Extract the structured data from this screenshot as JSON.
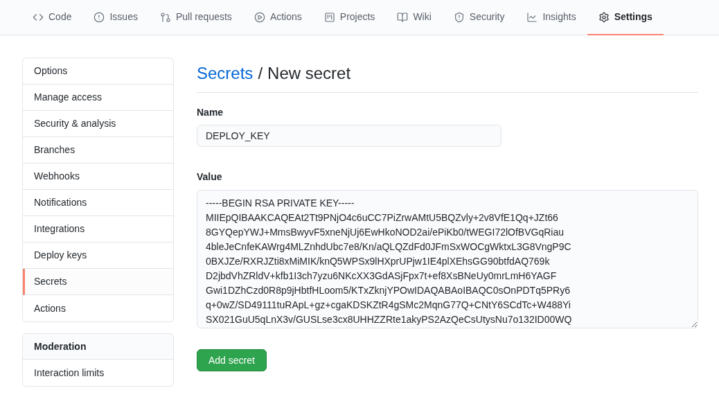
{
  "tabs": [
    {
      "kind": "code",
      "label": "Code",
      "selected": false
    },
    {
      "kind": "issues",
      "label": "Issues",
      "selected": false
    },
    {
      "kind": "pulls",
      "label": "Pull requests",
      "selected": false
    },
    {
      "kind": "actions",
      "label": "Actions",
      "selected": false
    },
    {
      "kind": "projects",
      "label": "Projects",
      "selected": false
    },
    {
      "kind": "wiki",
      "label": "Wiki",
      "selected": false
    },
    {
      "kind": "security",
      "label": "Security",
      "selected": false
    },
    {
      "kind": "insights",
      "label": "Insights",
      "selected": false
    },
    {
      "kind": "settings",
      "label": "Settings",
      "selected": true
    }
  ],
  "sidebar": {
    "items": [
      {
        "label": "Options",
        "selected": false
      },
      {
        "label": "Manage access",
        "selected": false
      },
      {
        "label": "Security & analysis",
        "selected": false
      },
      {
        "label": "Branches",
        "selected": false
      },
      {
        "label": "Webhooks",
        "selected": false
      },
      {
        "label": "Notifications",
        "selected": false
      },
      {
        "label": "Integrations",
        "selected": false
      },
      {
        "label": "Deploy keys",
        "selected": false
      },
      {
        "label": "Secrets",
        "selected": true
      },
      {
        "label": "Actions",
        "selected": false
      }
    ],
    "moderation": {
      "heading": "Moderation",
      "items": [
        {
          "label": "Interaction limits",
          "selected": false
        }
      ]
    }
  },
  "breadcrumb": {
    "link": "Secrets",
    "separator": "/",
    "current": "New secret"
  },
  "name_field": {
    "label": "Name",
    "value": "DEPLOY_KEY"
  },
  "value_field": {
    "label": "Value",
    "lines": [
      "-----BEGIN RSA PRIVATE KEY-----",
      "MIIEpQIBAAKCAQEAt2Tt9PNjO4c6uCC7PiZrwAMtU5BQZvly+2v8VfE1Qq+JZt66",
      "8GYQepYWJ+MmsBwyvF5xneNjUj6EwHkoNOD2ai/ePiKb0/tWEGI72lOfBVGqRiau",
      "4bleJeCnfeKAWrg4MLZnhdUbc7e8/Kn/aQLQZdFd0JFmSxWOCgWktxL3G8VngP9C",
      "0BXJZe/RXRJZti8xMiMIK/knQ5WPSx9lHXprUPjw1IE4plXEhsGG90btfdAQ769k",
      "D2jbdVhZRldV+kfb1I3ch7yzu6NKcXX3GdASjFpx7t+ef8XsBNeUy0mrLmH6YAGF",
      "Gwi1DZhCzd0R8p9jHbtfHLoom5/KTxZknjYPOwIDAQABAoIBAQC0sOnPDTq5PRy6",
      "q+0wZ/SD49111tuRApL+gz+cgaKDSKZtR4gSMc2MqnG77Q+CNtY6SCdTc+W488Yi",
      "SX021GuU5qLnX3v/GUSLse3cx8UHHZZRte1akyPS2AzQeCsUtysNu7o132ID00WQ"
    ]
  },
  "submit": {
    "label": "Add secret"
  }
}
